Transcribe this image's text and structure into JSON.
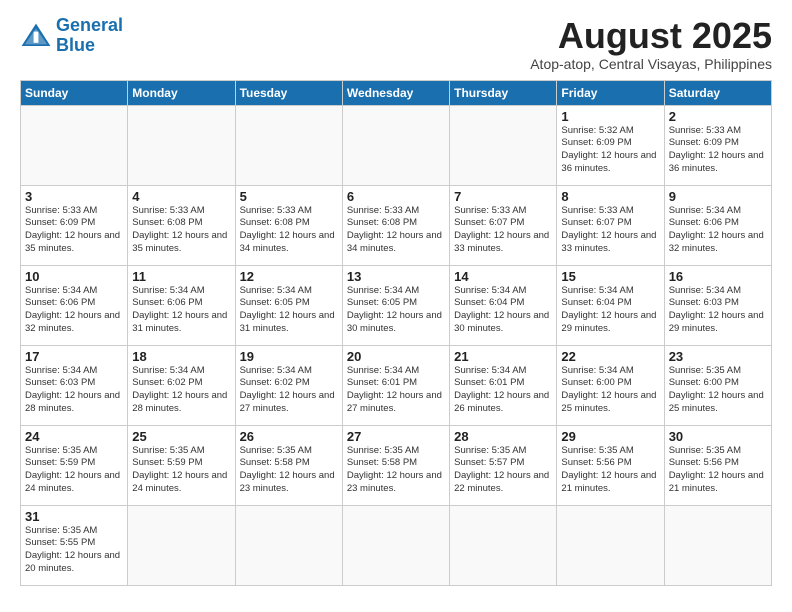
{
  "header": {
    "logo_general": "General",
    "logo_blue": "Blue",
    "month_title": "August 2025",
    "location": "Atop-atop, Central Visayas, Philippines"
  },
  "days_of_week": [
    "Sunday",
    "Monday",
    "Tuesday",
    "Wednesday",
    "Thursday",
    "Friday",
    "Saturday"
  ],
  "weeks": [
    [
      {
        "day": "",
        "info": ""
      },
      {
        "day": "",
        "info": ""
      },
      {
        "day": "",
        "info": ""
      },
      {
        "day": "",
        "info": ""
      },
      {
        "day": "",
        "info": ""
      },
      {
        "day": "1",
        "info": "Sunrise: 5:32 AM\nSunset: 6:09 PM\nDaylight: 12 hours and 36 minutes."
      },
      {
        "day": "2",
        "info": "Sunrise: 5:33 AM\nSunset: 6:09 PM\nDaylight: 12 hours and 36 minutes."
      }
    ],
    [
      {
        "day": "3",
        "info": "Sunrise: 5:33 AM\nSunset: 6:09 PM\nDaylight: 12 hours and 35 minutes."
      },
      {
        "day": "4",
        "info": "Sunrise: 5:33 AM\nSunset: 6:08 PM\nDaylight: 12 hours and 35 minutes."
      },
      {
        "day": "5",
        "info": "Sunrise: 5:33 AM\nSunset: 6:08 PM\nDaylight: 12 hours and 34 minutes."
      },
      {
        "day": "6",
        "info": "Sunrise: 5:33 AM\nSunset: 6:08 PM\nDaylight: 12 hours and 34 minutes."
      },
      {
        "day": "7",
        "info": "Sunrise: 5:33 AM\nSunset: 6:07 PM\nDaylight: 12 hours and 33 minutes."
      },
      {
        "day": "8",
        "info": "Sunrise: 5:33 AM\nSunset: 6:07 PM\nDaylight: 12 hours and 33 minutes."
      },
      {
        "day": "9",
        "info": "Sunrise: 5:34 AM\nSunset: 6:06 PM\nDaylight: 12 hours and 32 minutes."
      }
    ],
    [
      {
        "day": "10",
        "info": "Sunrise: 5:34 AM\nSunset: 6:06 PM\nDaylight: 12 hours and 32 minutes."
      },
      {
        "day": "11",
        "info": "Sunrise: 5:34 AM\nSunset: 6:06 PM\nDaylight: 12 hours and 31 minutes."
      },
      {
        "day": "12",
        "info": "Sunrise: 5:34 AM\nSunset: 6:05 PM\nDaylight: 12 hours and 31 minutes."
      },
      {
        "day": "13",
        "info": "Sunrise: 5:34 AM\nSunset: 6:05 PM\nDaylight: 12 hours and 30 minutes."
      },
      {
        "day": "14",
        "info": "Sunrise: 5:34 AM\nSunset: 6:04 PM\nDaylight: 12 hours and 30 minutes."
      },
      {
        "day": "15",
        "info": "Sunrise: 5:34 AM\nSunset: 6:04 PM\nDaylight: 12 hours and 29 minutes."
      },
      {
        "day": "16",
        "info": "Sunrise: 5:34 AM\nSunset: 6:03 PM\nDaylight: 12 hours and 29 minutes."
      }
    ],
    [
      {
        "day": "17",
        "info": "Sunrise: 5:34 AM\nSunset: 6:03 PM\nDaylight: 12 hours and 28 minutes."
      },
      {
        "day": "18",
        "info": "Sunrise: 5:34 AM\nSunset: 6:02 PM\nDaylight: 12 hours and 28 minutes."
      },
      {
        "day": "19",
        "info": "Sunrise: 5:34 AM\nSunset: 6:02 PM\nDaylight: 12 hours and 27 minutes."
      },
      {
        "day": "20",
        "info": "Sunrise: 5:34 AM\nSunset: 6:01 PM\nDaylight: 12 hours and 27 minutes."
      },
      {
        "day": "21",
        "info": "Sunrise: 5:34 AM\nSunset: 6:01 PM\nDaylight: 12 hours and 26 minutes."
      },
      {
        "day": "22",
        "info": "Sunrise: 5:34 AM\nSunset: 6:00 PM\nDaylight: 12 hours and 25 minutes."
      },
      {
        "day": "23",
        "info": "Sunrise: 5:35 AM\nSunset: 6:00 PM\nDaylight: 12 hours and 25 minutes."
      }
    ],
    [
      {
        "day": "24",
        "info": "Sunrise: 5:35 AM\nSunset: 5:59 PM\nDaylight: 12 hours and 24 minutes."
      },
      {
        "day": "25",
        "info": "Sunrise: 5:35 AM\nSunset: 5:59 PM\nDaylight: 12 hours and 24 minutes."
      },
      {
        "day": "26",
        "info": "Sunrise: 5:35 AM\nSunset: 5:58 PM\nDaylight: 12 hours and 23 minutes."
      },
      {
        "day": "27",
        "info": "Sunrise: 5:35 AM\nSunset: 5:58 PM\nDaylight: 12 hours and 23 minutes."
      },
      {
        "day": "28",
        "info": "Sunrise: 5:35 AM\nSunset: 5:57 PM\nDaylight: 12 hours and 22 minutes."
      },
      {
        "day": "29",
        "info": "Sunrise: 5:35 AM\nSunset: 5:56 PM\nDaylight: 12 hours and 21 minutes."
      },
      {
        "day": "30",
        "info": "Sunrise: 5:35 AM\nSunset: 5:56 PM\nDaylight: 12 hours and 21 minutes."
      }
    ],
    [
      {
        "day": "31",
        "info": "Sunrise: 5:35 AM\nSunset: 5:55 PM\nDaylight: 12 hours and 20 minutes."
      },
      {
        "day": "",
        "info": ""
      },
      {
        "day": "",
        "info": ""
      },
      {
        "day": "",
        "info": ""
      },
      {
        "day": "",
        "info": ""
      },
      {
        "day": "",
        "info": ""
      },
      {
        "day": "",
        "info": ""
      }
    ]
  ]
}
